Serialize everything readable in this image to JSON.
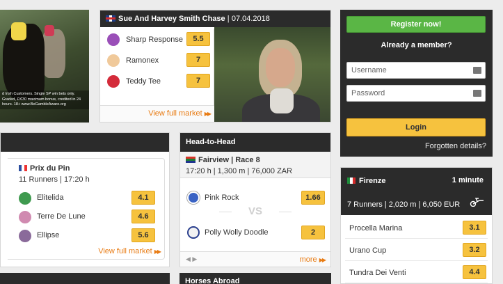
{
  "promo": {
    "text": "d Irish Customers. Single SP win bets only. Graded, £/€30 maximum bonus, credited in 24 hours. 18+ www.BeGambleAware.org"
  },
  "featured": {
    "title": "Sue And Harvey Smith Chase",
    "date": "07.04.2018",
    "runners": [
      {
        "name": "Sharp Response",
        "odds": "5.5",
        "silk_color": "#9a4fb8"
      },
      {
        "name": "Ramonex",
        "odds": "7",
        "silk_color": "#f0c99a"
      },
      {
        "name": "Teddy Tee",
        "odds": "7",
        "silk_color": "#d42b3a"
      }
    ],
    "view_full_label": "View full market",
    "slides": 7
  },
  "login": {
    "register_label": "Register now!",
    "member_text": "Already a member?",
    "username_placeholder": "Username",
    "password_placeholder": "Password",
    "login_label": "Login",
    "forgot_label": "Forgotten details?"
  },
  "race": {
    "title": "Prix du Pin",
    "subtitle": "11 Runners | 17:20 h",
    "runners": [
      {
        "name": "Elitelida",
        "odds": "4.1",
        "silk_color": "#3f9a4f"
      },
      {
        "name": "Terre De Lune",
        "odds": "4.6",
        "silk_color": "#d08ab0"
      },
      {
        "name": "Ellipse",
        "odds": "5.6",
        "silk_color": "#8a6a9a"
      }
    ],
    "view_full_label": "View full market"
  },
  "h2h": {
    "header": "Head-to-Head",
    "title": "Fairview | Race 8",
    "subtitle": "17:20 h | 1,300 m | 76,000 ZAR",
    "runner1": {
      "name": "Pink Rock",
      "odds": "1.66"
    },
    "runner2": {
      "name": "Polly Wolly Doodle",
      "odds": "2"
    },
    "vs_label": "VS",
    "more_label": "more"
  },
  "firenze": {
    "title": "Firenze",
    "timer": "1 minute",
    "subtitle": "7 Runners | 2,020 m | 6,050 EUR",
    "runners": [
      {
        "name": "Procella Marina",
        "odds": "3.1"
      },
      {
        "name": "Urano Cup",
        "odds": "3.2"
      },
      {
        "name": "Tundra Dei Venti",
        "odds": "4.4"
      }
    ]
  },
  "bottom": {
    "mid_header": "Horses Abroad"
  }
}
